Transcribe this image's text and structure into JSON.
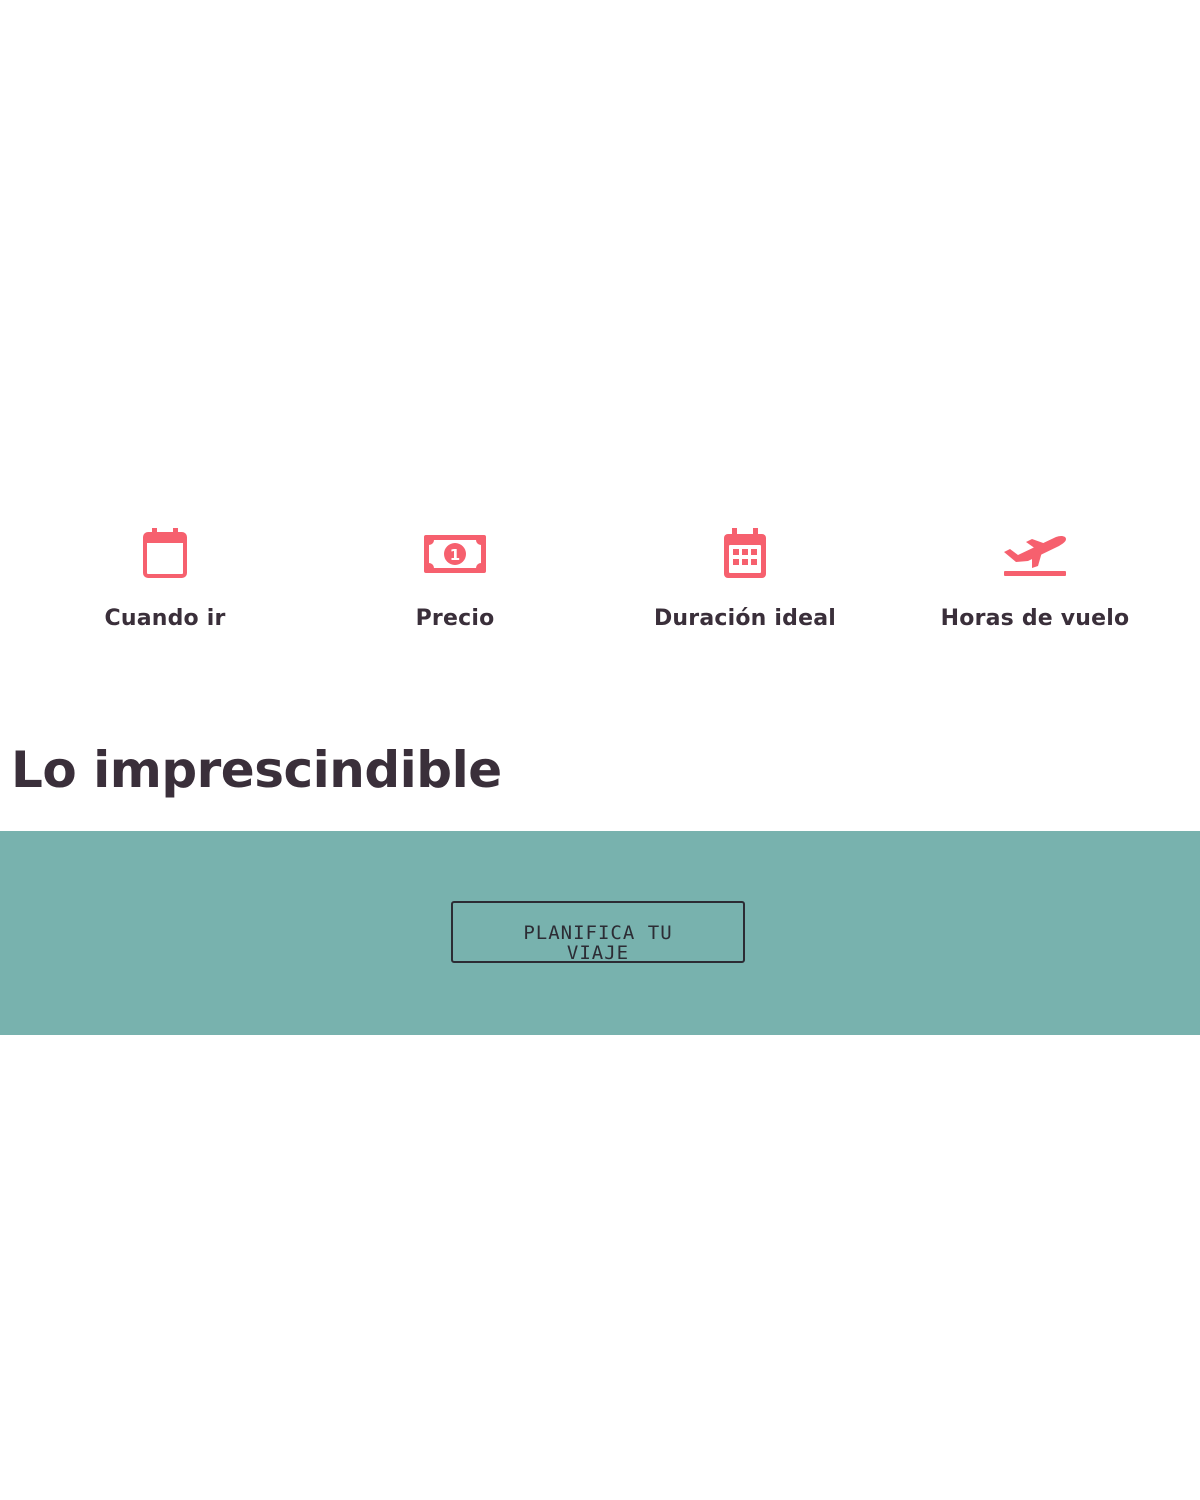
{
  "colors": {
    "accent": "#f6606e",
    "text": "#3a2f3a",
    "band": "#78b2ae",
    "button_border": "#2c2c34"
  },
  "features": [
    {
      "label": "Cuando ir",
      "icon": "calendar-icon"
    },
    {
      "label": "Precio",
      "icon": "banknote-icon"
    },
    {
      "label": "Duración ideal",
      "icon": "calendar-grid-icon"
    },
    {
      "label": "Horas de vuelo",
      "icon": "airplane-takeoff-icon"
    }
  ],
  "section": {
    "title": "Lo imprescindible"
  },
  "cta": {
    "label": "PLANIFICA TU VIAJE"
  }
}
